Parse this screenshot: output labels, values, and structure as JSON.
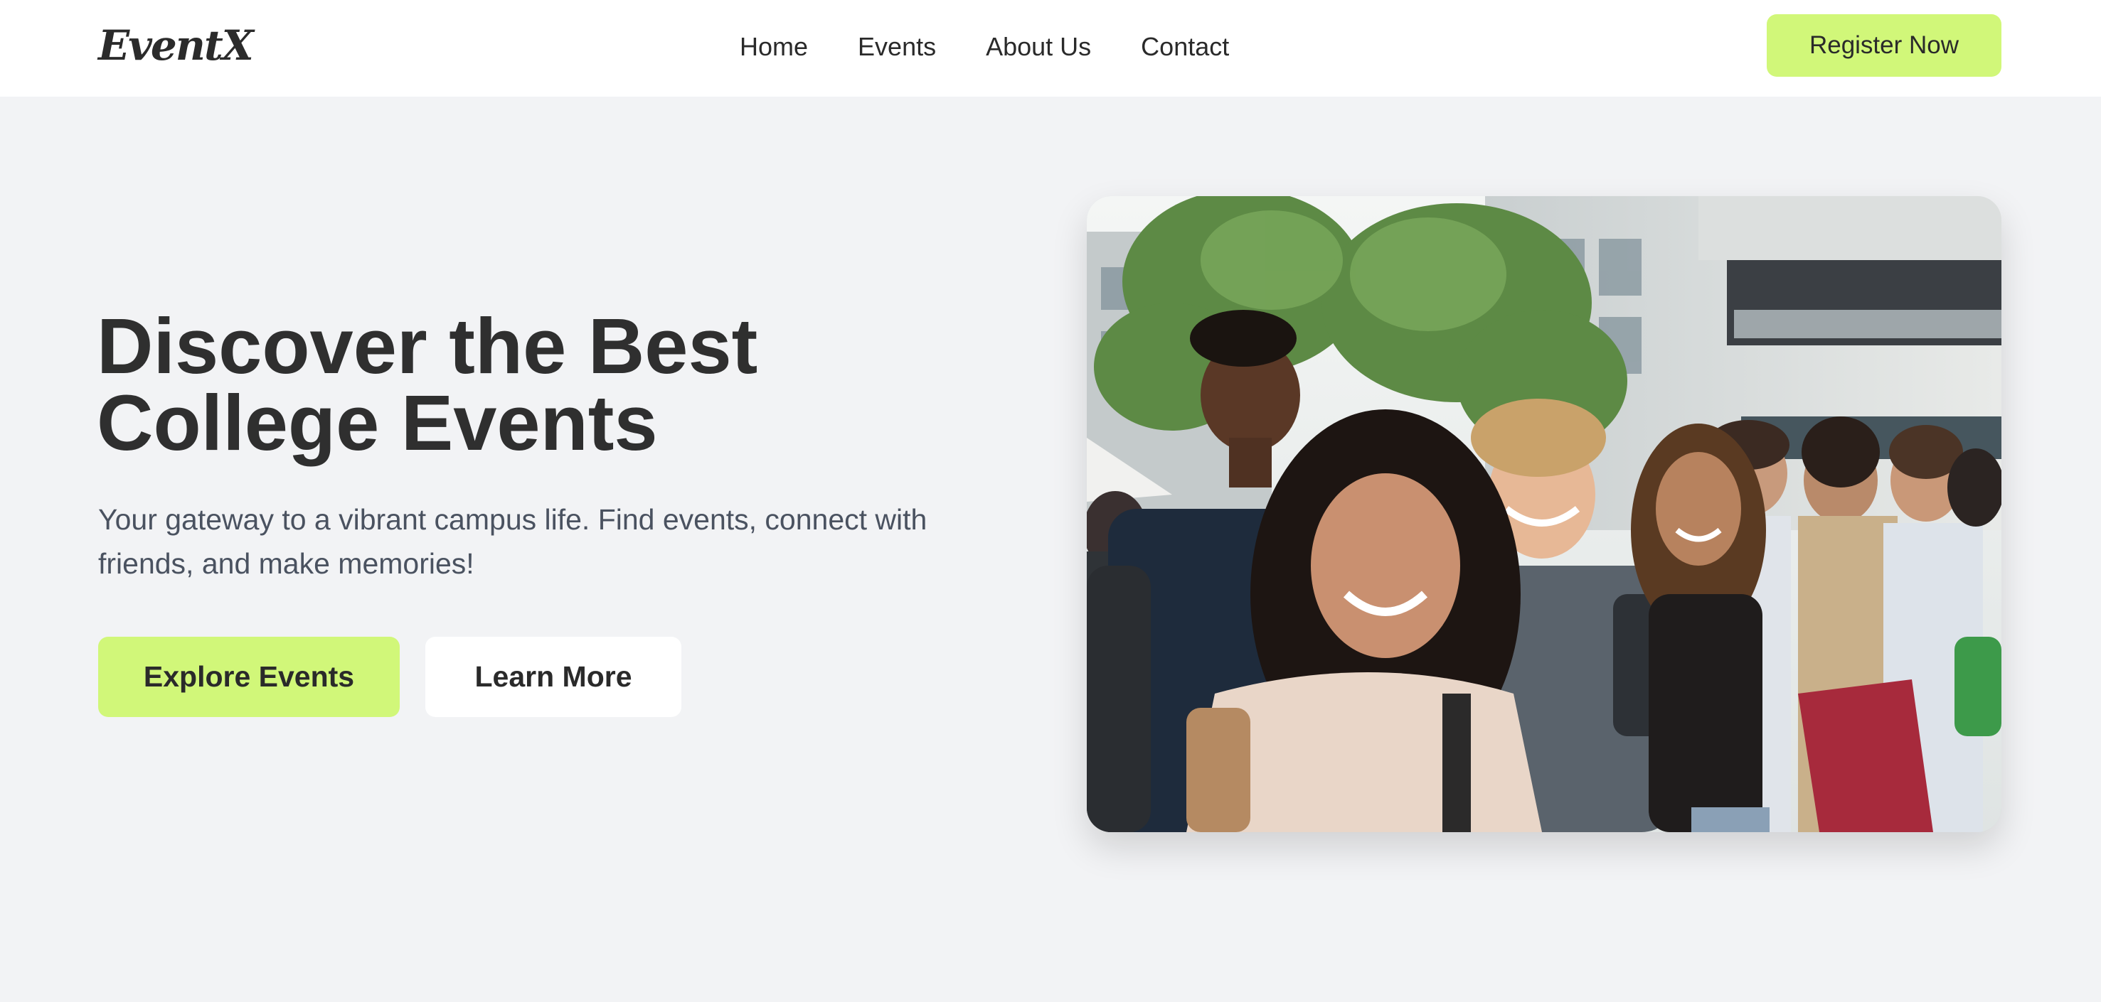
{
  "brand": {
    "logo_text": "EventX"
  },
  "nav": {
    "items": [
      {
        "label": "Home"
      },
      {
        "label": "Events"
      },
      {
        "label": "About Us"
      },
      {
        "label": "Contact"
      }
    ],
    "cta_label": "Register Now"
  },
  "hero": {
    "title_line_1": "Discover the Best",
    "title_line_2": "College Events",
    "subtitle": "Your gateway to a vibrant campus life. Find events, connect with friends, and make memories!",
    "primary_button": "Explore Events",
    "secondary_button": "Learn More"
  },
  "colors": {
    "accent": "#d1f779",
    "page_background": "#f2f3f5",
    "header_background": "#ffffff",
    "text_dark": "#2f2f2f",
    "text_muted": "#4a5260"
  }
}
